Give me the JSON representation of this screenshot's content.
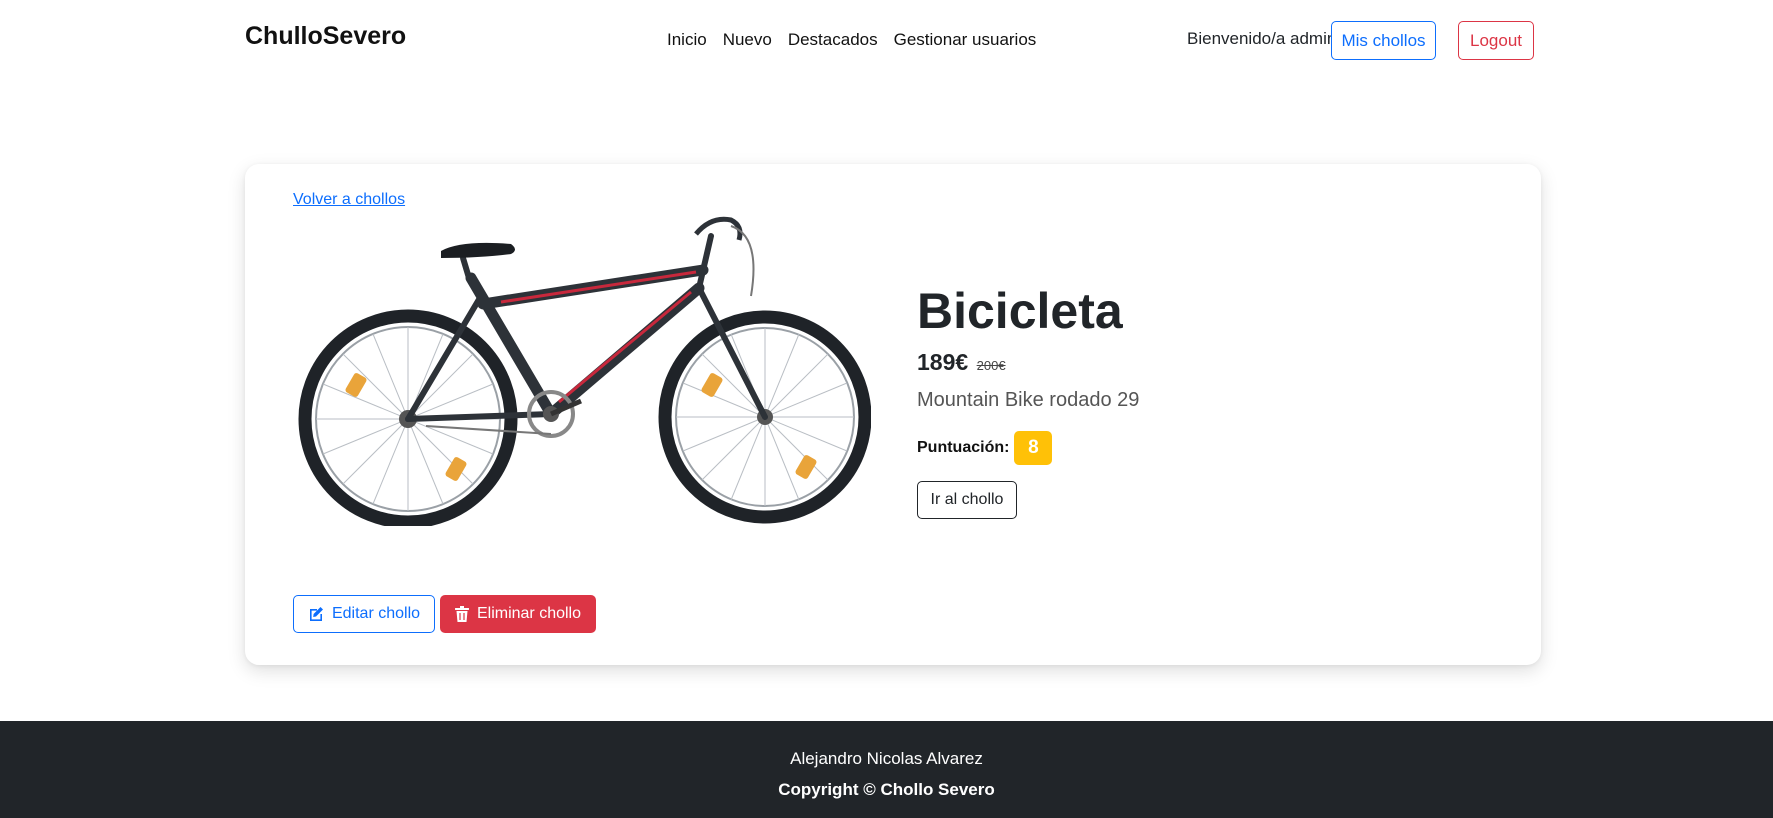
{
  "navbar": {
    "brand": "ChulloSevero",
    "links": [
      "Inicio",
      "Nuevo",
      "Destacados",
      "Gestionar usuarios"
    ],
    "welcome": "Bienvenido/a admin",
    "mis_chollos": "Mis chollos",
    "logout": "Logout"
  },
  "card": {
    "back_link": "Volver a chollos",
    "title": "Bicicleta",
    "price": "189€",
    "old_price": "200€",
    "description": "Mountain Bike rodado 29",
    "score_label": "Puntuación:",
    "score": "8",
    "go_button": "Ir al chollo",
    "edit_button": "Editar chollo",
    "delete_button": "Eliminar chollo",
    "image_icon": "bicycle-image"
  },
  "footer": {
    "author": "Alejandro Nicolas Alvarez",
    "copyright": "Copyright © Chollo Severo"
  },
  "colors": {
    "primary": "#0d6efd",
    "danger": "#dc3545",
    "warning": "#ffc107",
    "dark": "#212529"
  }
}
